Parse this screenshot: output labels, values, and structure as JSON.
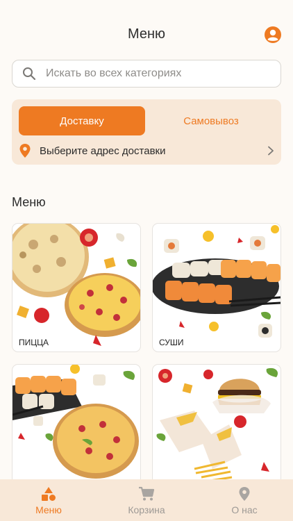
{
  "header": {
    "title": "Меню"
  },
  "search": {
    "placeholder": "Искать во всех категориях"
  },
  "delivery": {
    "mode_delivery": "Доставку",
    "mode_pickup": "Самовывоз",
    "address_prompt": "Выберите адрес доставки"
  },
  "menu": {
    "section_title": "Меню",
    "categories": [
      {
        "label": "ПИЦЦА"
      },
      {
        "label": "СУШИ"
      },
      {
        "label": ""
      },
      {
        "label": ""
      }
    ]
  },
  "tabbar": {
    "tabs": [
      {
        "label": "Меню",
        "icon": "menu-shapes-icon",
        "active": true
      },
      {
        "label": "Корзина",
        "icon": "cart-icon",
        "active": false
      },
      {
        "label": "О нас",
        "icon": "location-pin-icon",
        "active": false
      }
    ]
  },
  "colors": {
    "accent": "#ee7a22",
    "card_bg": "#f8e8d8",
    "page_bg": "#fdfaf6"
  }
}
